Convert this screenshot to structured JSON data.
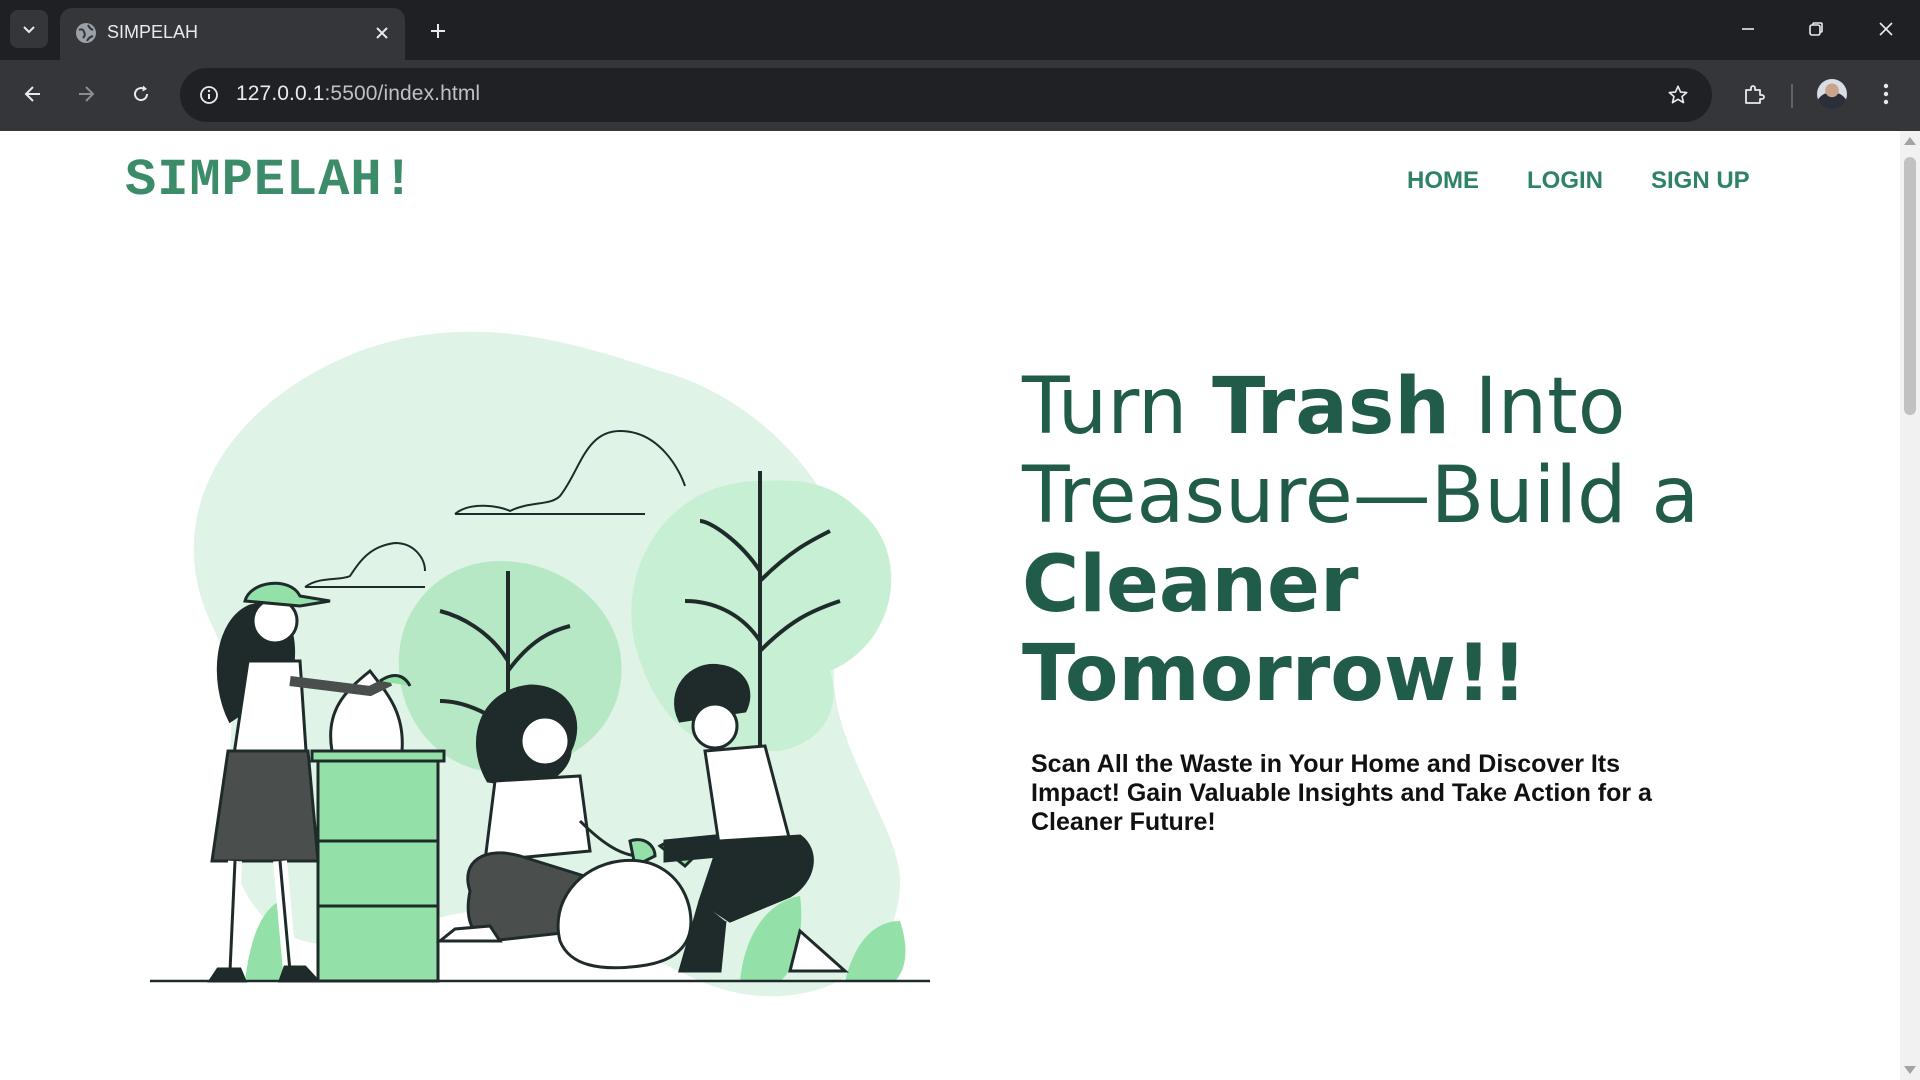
{
  "browser": {
    "tab_title": "SIMPELAH",
    "url_host": "127.0.0.1",
    "url_rest": ":5500/index.html",
    "icons": [
      "tab-search-icon",
      "globe-icon",
      "close-icon",
      "plus-icon",
      "minimize-icon",
      "restore-icon",
      "window-close-icon",
      "back-arrow-icon",
      "forward-arrow-icon",
      "reload-icon",
      "site-info-icon",
      "star-icon",
      "extensions-icon",
      "profile-avatar",
      "more-vert-icon"
    ]
  },
  "site": {
    "logo": "SIMPELAH!",
    "nav": [
      "HOME",
      "LOGIN",
      "SIGN UP"
    ],
    "headline": {
      "turn": "Turn ",
      "trash": "Trash",
      "into": " Into Treasure—Build a ",
      "cleaner": "Cleaner Tomorrow!!"
    },
    "subtext": "Scan All the Waste in Your Home and Discover Its Impact! Gain Valuable Insights and Take Action for a Cleaner Future!"
  },
  "colors": {
    "brand_green": "#3c8c6a",
    "nav_green": "#2f8266",
    "headline_green": "#215c4b",
    "illustration_light": "#dff4e6",
    "illustration_mid": "#93e0a8"
  }
}
